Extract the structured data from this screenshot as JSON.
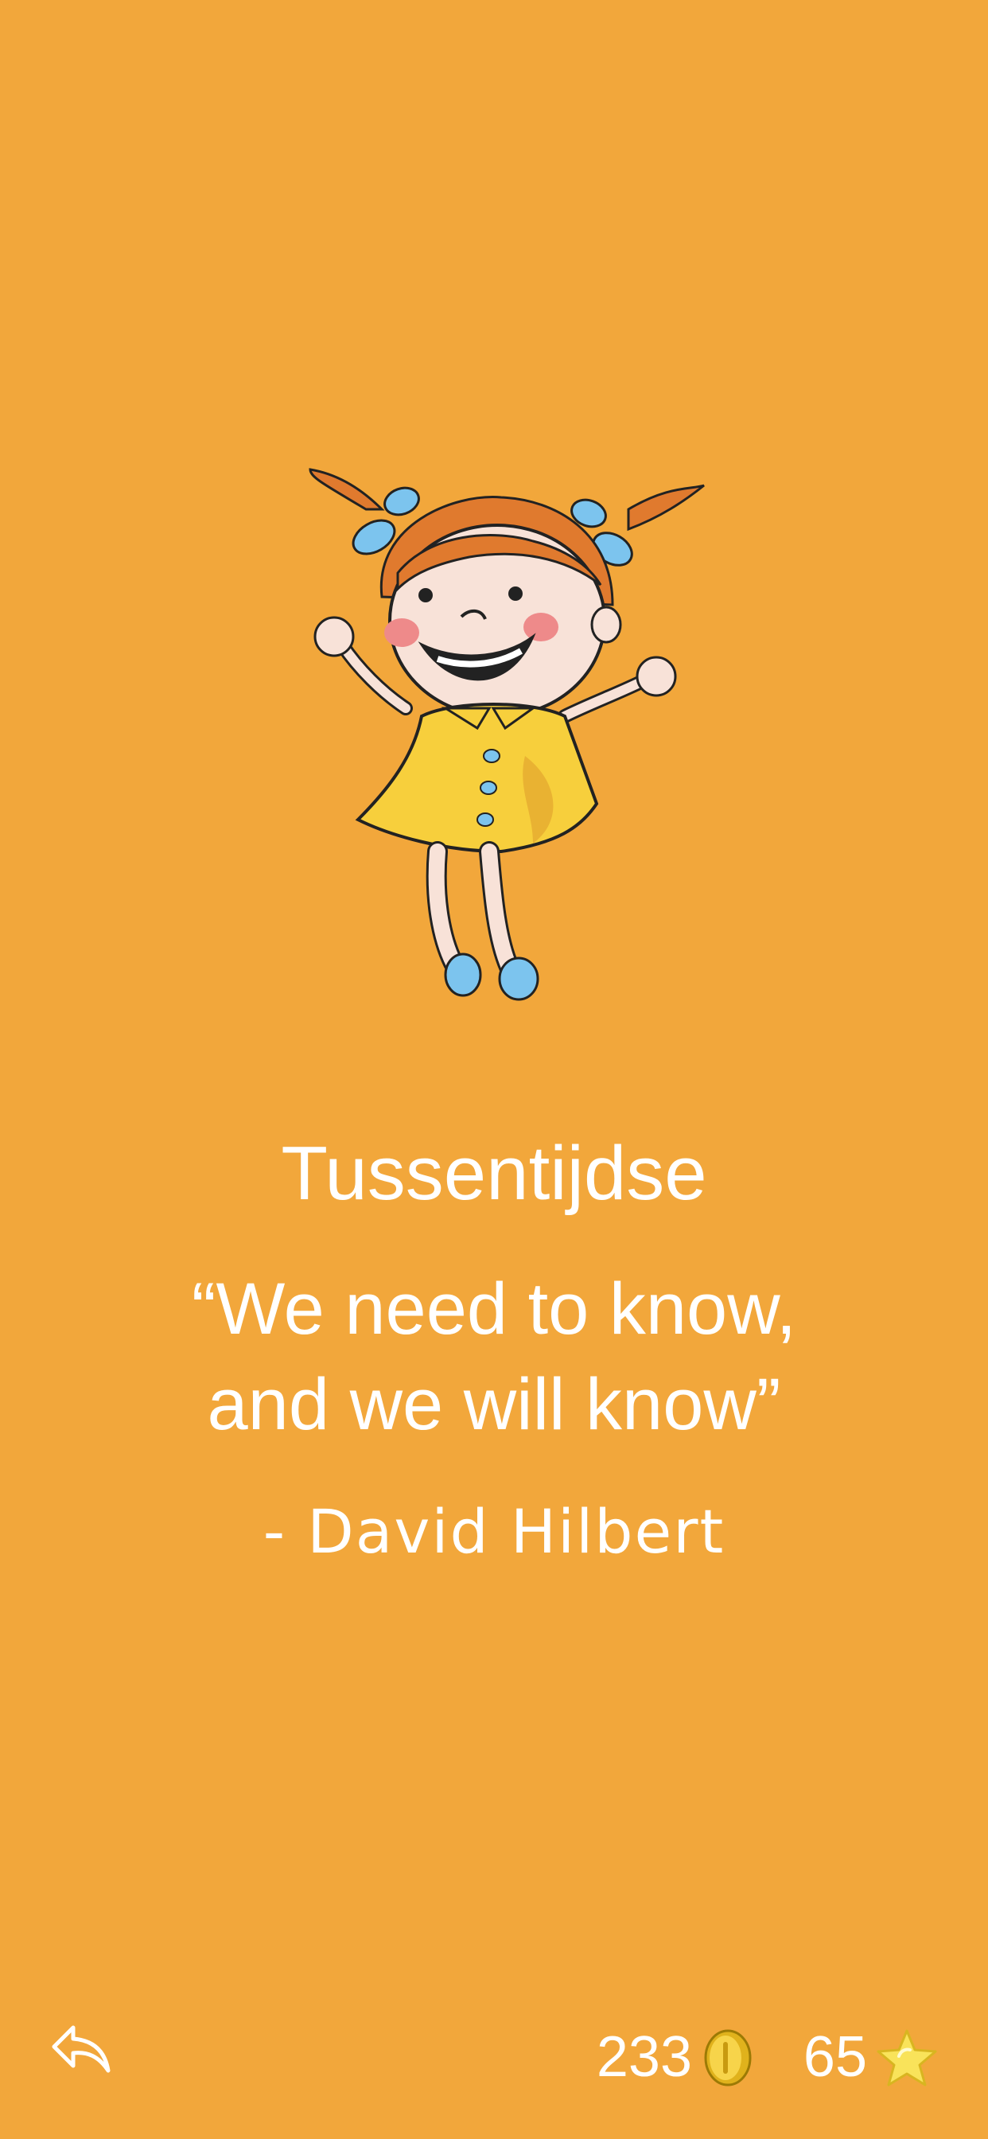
{
  "screen": {
    "background_color": "#F2A73B"
  },
  "content": {
    "title": "Tussentijdse",
    "quote_line1": "“We need to know,",
    "quote_line2": "and we will know”",
    "author": "- David Hilbert"
  },
  "footer": {
    "back_icon": "reply-arrow-icon",
    "coins": "233",
    "coin_icon": "gold-coin-icon",
    "stars": "65",
    "star_icon": "yellow-star-icon"
  }
}
